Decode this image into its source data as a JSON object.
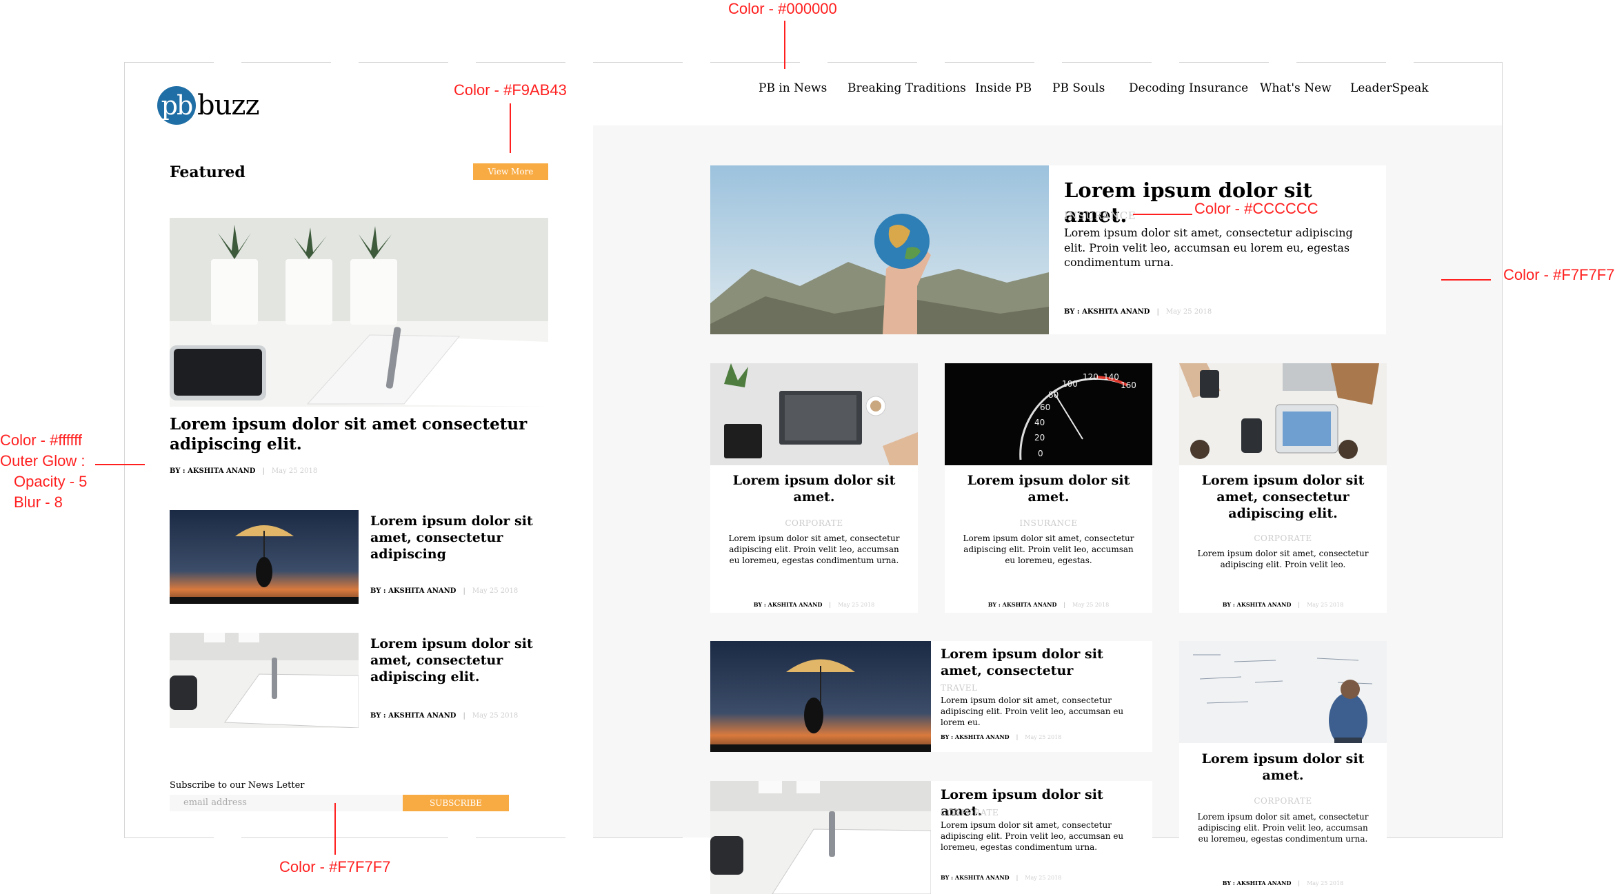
{
  "annotations": {
    "nav_color": "Color - #000000",
    "button_color": "Color - #F9AB43",
    "category_color": "Color - #CCCCCC",
    "panel_color": "Color - #F7F7F7",
    "glow": [
      "Color - #ffffff",
      "Outer Glow :",
      "Opacity - 5",
      "Blur - 8"
    ],
    "input_color": "Color - #F7F7F7"
  },
  "colors": {
    "brand": "#1f6ea5",
    "accent": "#F9AB43",
    "category": "#CCCCCC",
    "panel": "#F7F7F7"
  },
  "logo": {
    "mark": "pb",
    "text": "buzz"
  },
  "nav": [
    "PB in News",
    "Breaking Traditions",
    "Inside PB",
    "PB Souls",
    "Decoding Insurance",
    "What's New",
    "LeaderSpeak"
  ],
  "left": {
    "featured_title": "Featured",
    "view_more": "View More",
    "main_story": {
      "title": "Lorem ipsum dolor sit amet consectetur adipiscing elit.",
      "author": "BY : AKSHITA ANAND",
      "date": "May 25 2018"
    },
    "small_stories": [
      {
        "title": "Lorem ipsum dolor sit amet, consectetur adipiscing",
        "author": "BY : AKSHITA ANAND",
        "date": "May 25 2018"
      },
      {
        "title": "Lorem ipsum dolor sit amet, consectetur adipiscing elit.",
        "author": "BY : AKSHITA ANAND",
        "date": "May 25 2018"
      }
    ],
    "newsletter": {
      "label": "Subscribe to our News Letter",
      "placeholder": "email address",
      "button": "SUBSCRIBE"
    }
  },
  "right": {
    "hero": {
      "title": "Lorem ipsum dolor sit amet.",
      "category": "INSURANCE",
      "text": "Lorem ipsum dolor sit amet, consectetur adipiscing elit. Proin velit leo, accumsan eu lorem eu, egestas condimentum urna.",
      "author": "BY : AKSHITA ANAND",
      "date": "May 25 2018"
    },
    "cards": [
      {
        "title": "Lorem ipsum dolor sit amet.",
        "category": "CORPORATE",
        "text": "Lorem ipsum dolor sit amet, consectetur adipiscing elit. Proin velit leo, accumsan eu loremeu, egestas condimentum urna.",
        "author": "BY : AKSHITA ANAND",
        "date": "May 25 2018"
      },
      {
        "title": "Lorem ipsum dolor sit amet.",
        "category": "INSURANCE",
        "text": "Lorem ipsum dolor sit amet, consectetur adipiscing elit. Proin velit leo, accumsan eu loremeu, egestas.",
        "author": "BY : AKSHITA ANAND",
        "date": "May 25 2018"
      },
      {
        "title": "Lorem ipsum dolor sit amet, consectetur adipiscing elit.",
        "category": "CORPORATE",
        "text": "Lorem ipsum dolor sit amet, consectetur adipiscing elit. Proin velit leo.",
        "author": "BY : AKSHITA ANAND",
        "date": "May 25 2018"
      }
    ],
    "wide_cards": [
      {
        "title": "Lorem ipsum dolor sit amet, consectetur",
        "category": "TRAVEL",
        "text": "Lorem ipsum dolor sit amet, consectetur adipiscing elit. Proin velit leo, accumsan eu lorem eu.",
        "author": "BY : AKSHITA ANAND",
        "date": "May 25 2018"
      },
      {
        "title": "Lorem ipsum dolor sit amet.",
        "category": "CORPORATE",
        "text": "Lorem ipsum dolor sit amet, consectetur adipiscing elit. Proin velit leo, accumsan eu loremeu, egestas condimentum urna.",
        "author": "BY : AKSHITA ANAND",
        "date": "May 25 2018"
      }
    ],
    "tall_card": {
      "title": "Lorem ipsum dolor sit amet.",
      "category": "CORPORATE",
      "text": "Lorem ipsum dolor sit amet, consectetur adipiscing elit. Proin velit leo, accumsan eu loremeu, egestas condimentum urna.",
      "author": "BY : AKSHITA ANAND",
      "date": "May 25 2018"
    }
  }
}
